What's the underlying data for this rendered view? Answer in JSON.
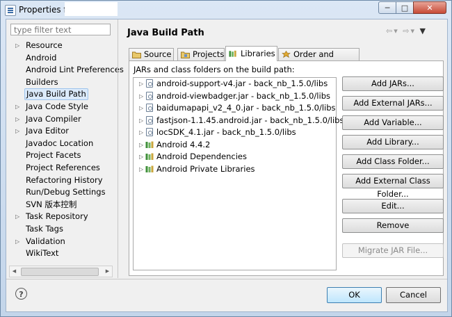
{
  "window": {
    "title": "Properties fo"
  },
  "filter": {
    "placeholder": "type filter text"
  },
  "tree": [
    {
      "label": "Resource",
      "expandable": true
    },
    {
      "label": "Android",
      "expandable": false
    },
    {
      "label": "Android Lint Preferences",
      "expandable": false
    },
    {
      "label": "Builders",
      "expandable": false
    },
    {
      "label": "Java Build Path",
      "expandable": false,
      "selected": true
    },
    {
      "label": "Java Code Style",
      "expandable": true
    },
    {
      "label": "Java Compiler",
      "expandable": true
    },
    {
      "label": "Java Editor",
      "expandable": true
    },
    {
      "label": "Javadoc Location",
      "expandable": false
    },
    {
      "label": "Project Facets",
      "expandable": false
    },
    {
      "label": "Project References",
      "expandable": false
    },
    {
      "label": "Refactoring History",
      "expandable": false
    },
    {
      "label": "Run/Debug Settings",
      "expandable": false
    },
    {
      "label": "SVN 版本控制",
      "expandable": false
    },
    {
      "label": "Task Repository",
      "expandable": true
    },
    {
      "label": "Task Tags",
      "expandable": false
    },
    {
      "label": "Validation",
      "expandable": true
    },
    {
      "label": "WikiText",
      "expandable": false
    }
  ],
  "page": {
    "title": "Java Build Path"
  },
  "tabs": [
    {
      "label": "Source",
      "icon": "source-folder-icon"
    },
    {
      "label": "Projects",
      "icon": "projects-folder-icon"
    },
    {
      "label": "Libraries",
      "icon": "libraries-icon",
      "active": true
    },
    {
      "label": "Order and Export",
      "icon": "order-export-icon"
    }
  ],
  "libraries": {
    "label": "JARs and class folders on the build path:",
    "items": [
      {
        "label": "android-support-v4.jar - back_nb_1.5.0/libs",
        "icon": "jar-icon"
      },
      {
        "label": "android-viewbadger.jar - back_nb_1.5.0/libs",
        "icon": "jar-icon"
      },
      {
        "label": "baidumapapi_v2_4_0.jar - back_nb_1.5.0/libs",
        "icon": "jar-icon"
      },
      {
        "label": "fastjson-1.1.45.android.jar - back_nb_1.5.0/libs",
        "icon": "jar-icon"
      },
      {
        "label": "locSDK_4.1.jar - back_nb_1.5.0/libs",
        "icon": "jar-icon"
      },
      {
        "label": "Android 4.4.2",
        "icon": "library-icon"
      },
      {
        "label": "Android Dependencies",
        "icon": "library-icon"
      },
      {
        "label": "Android Private Libraries",
        "icon": "library-icon"
      }
    ]
  },
  "buttons": [
    {
      "label": "Add JARs...",
      "enabled": true
    },
    {
      "label": "Add External JARs...",
      "enabled": true
    },
    {
      "label": "Add Variable...",
      "enabled": true
    },
    {
      "label": "Add Library...",
      "enabled": true
    },
    {
      "label": "Add Class Folder...",
      "enabled": true
    },
    {
      "label": "Add External Class Folder...",
      "enabled": true
    },
    {
      "label": "Edit...",
      "enabled": true
    },
    {
      "label": "Remove",
      "enabled": true
    },
    {
      "label": "Migrate JAR File...",
      "enabled": false
    }
  ],
  "footer": {
    "help": "?",
    "ok": "OK",
    "cancel": "Cancel"
  },
  "colors": {
    "selection": "#dbeafa",
    "default_button": "#bee6fd",
    "library_green": "#3f8f3a"
  }
}
